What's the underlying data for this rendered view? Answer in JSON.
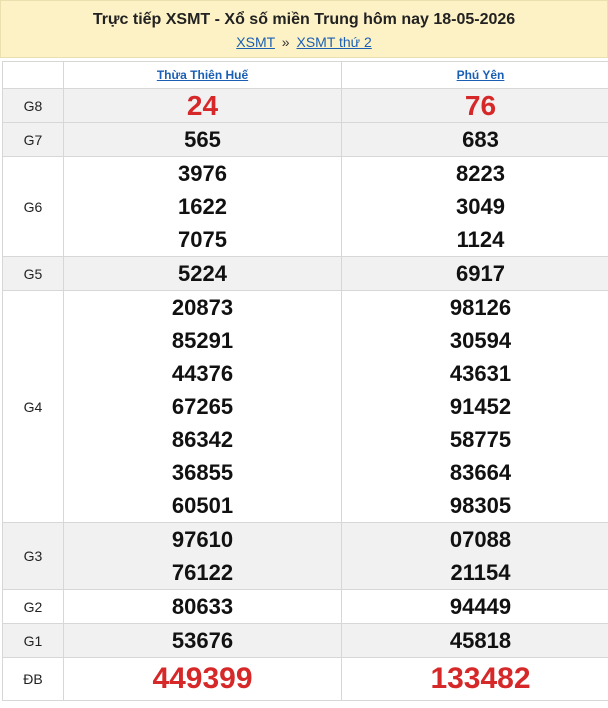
{
  "header": {
    "title": "Trực tiếp XSMT - Xổ số miền Trung hôm nay 18-05-2026",
    "crumb_1": "XSMT",
    "crumb_sep": "»",
    "crumb_2": "XSMT thứ 2"
  },
  "provinces": [
    "Thừa Thiên Huế",
    "Phú Yên"
  ],
  "prizes": {
    "g8": {
      "label": "G8",
      "p1": [
        "24"
      ],
      "p2": [
        "76"
      ]
    },
    "g7": {
      "label": "G7",
      "p1": [
        "565"
      ],
      "p2": [
        "683"
      ]
    },
    "g6": {
      "label": "G6",
      "p1": [
        "3976",
        "1622",
        "7075"
      ],
      "p2": [
        "8223",
        "3049",
        "1124"
      ]
    },
    "g5": {
      "label": "G5",
      "p1": [
        "5224"
      ],
      "p2": [
        "6917"
      ]
    },
    "g4": {
      "label": "G4",
      "p1": [
        "20873",
        "85291",
        "44376",
        "67265",
        "86342",
        "36855",
        "60501"
      ],
      "p2": [
        "98126",
        "30594",
        "43631",
        "91452",
        "58775",
        "83664",
        "98305"
      ]
    },
    "g3": {
      "label": "G3",
      "p1": [
        "97610",
        "76122"
      ],
      "p2": [
        "07088",
        "21154"
      ]
    },
    "g2": {
      "label": "G2",
      "p1": [
        "80633"
      ],
      "p2": [
        "94449"
      ]
    },
    "g1": {
      "label": "G1",
      "p1": [
        "53676"
      ],
      "p2": [
        "45818"
      ]
    },
    "db": {
      "label": "ĐB",
      "p1": [
        "449399"
      ],
      "p2": [
        "133482"
      ]
    }
  },
  "colors": {
    "accent_red": "#d62828",
    "link_blue": "#1a5fb4",
    "header_bg": "#fdf2c6"
  }
}
